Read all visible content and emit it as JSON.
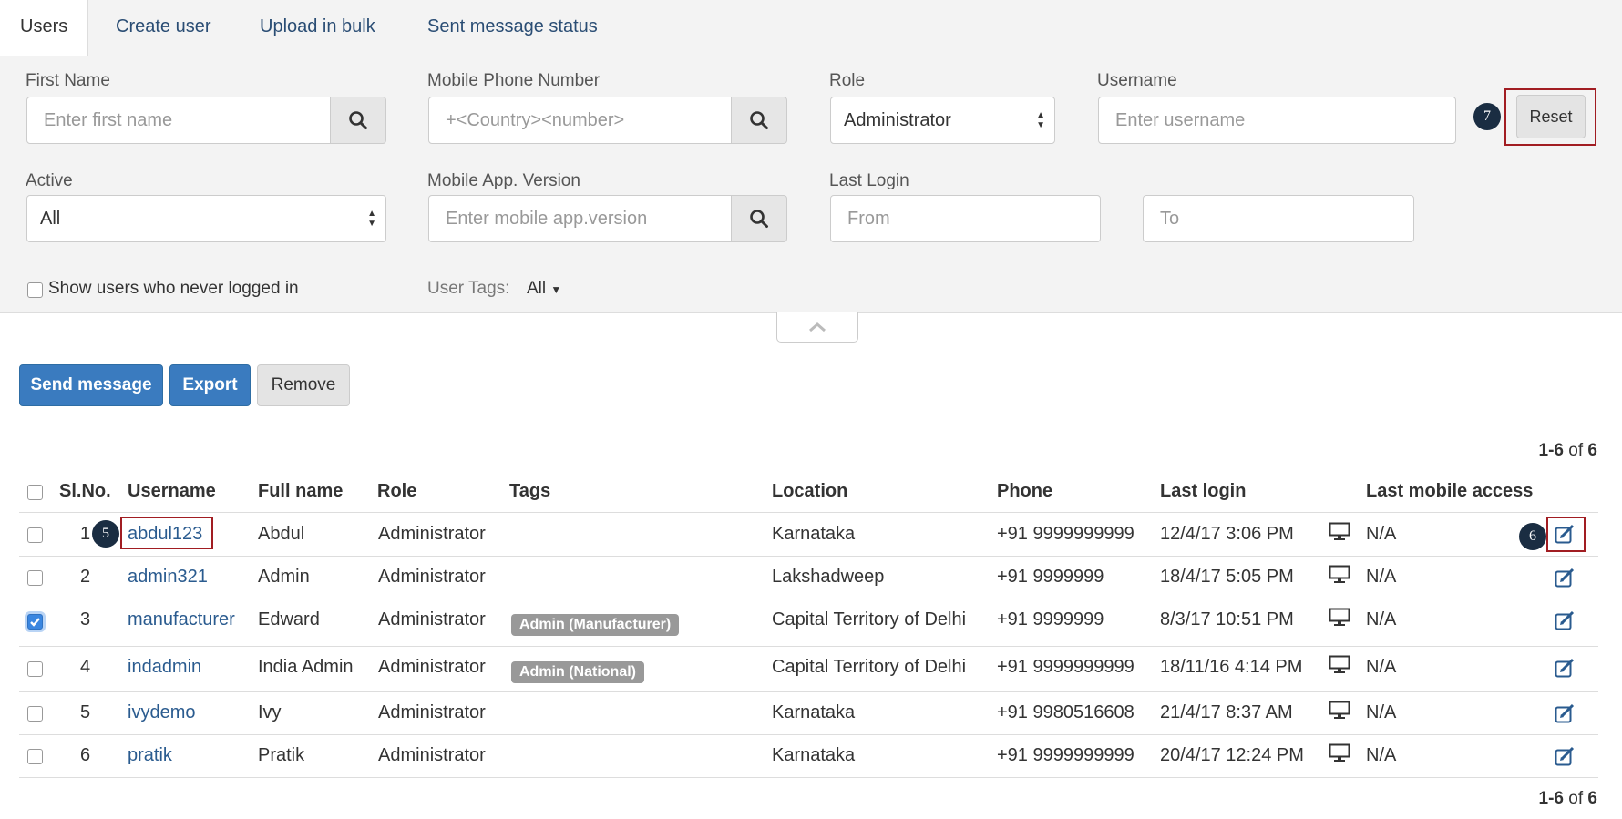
{
  "tabs": [
    {
      "label": "Users"
    },
    {
      "label": "Create user"
    },
    {
      "label": "Upload in bulk"
    },
    {
      "label": "Sent message status"
    }
  ],
  "filters": {
    "first_name": {
      "label": "First Name",
      "placeholder": "Enter first name"
    },
    "mobile_phone": {
      "label": "Mobile Phone Number",
      "placeholder": "+<Country><number>"
    },
    "role": {
      "label": "Role",
      "value": "Administrator"
    },
    "username": {
      "label": "Username",
      "placeholder": "Enter username"
    },
    "reset_label": "Reset",
    "active": {
      "label": "Active",
      "value": "All"
    },
    "app_version": {
      "label": "Mobile App. Version",
      "placeholder": "Enter mobile app.version"
    },
    "last_login": {
      "label": "Last Login",
      "from_placeholder": "From",
      "to_placeholder": "To"
    },
    "never_logged_in_label": "Show users who never logged in",
    "user_tags": {
      "label": "User Tags:",
      "value": "All"
    }
  },
  "callouts": {
    "five": "5",
    "six": "6",
    "seven": "7"
  },
  "actions": {
    "send_message": "Send message",
    "export": "Export",
    "remove": "Remove"
  },
  "pager": {
    "range": "1-6",
    "of": "of",
    "total": "6"
  },
  "table": {
    "headers": {
      "slno": "Sl.No.",
      "username": "Username",
      "fullname": "Full name",
      "role": "Role",
      "tags": "Tags",
      "location": "Location",
      "phone": "Phone",
      "last_login": "Last login",
      "last_mobile": "Last mobile access"
    },
    "rows": [
      {
        "slno": "1",
        "username": "abdul123",
        "fullname": "Abdul",
        "role": "Administrator",
        "tag": "",
        "location": "Karnataka",
        "phone": "+91 9999999999",
        "last_login": "12/4/17 3:06 PM",
        "last_mobile": "N/A",
        "checked": false
      },
      {
        "slno": "2",
        "username": "admin321",
        "fullname": "Admin",
        "role": "Administrator",
        "tag": "",
        "location": "Lakshadweep",
        "phone": "+91 9999999",
        "last_login": "18/4/17 5:05 PM",
        "last_mobile": "N/A",
        "checked": false
      },
      {
        "slno": "3",
        "username": "manufacturer",
        "fullname": "Edward",
        "role": "Administrator",
        "tag": "Admin (Manufacturer)",
        "location": "Capital Territory of Delhi",
        "phone": "+91 9999999",
        "last_login": "8/3/17 10:51 PM",
        "last_mobile": "N/A",
        "checked": true
      },
      {
        "slno": "4",
        "username": "indadmin",
        "fullname": "India Admin",
        "role": "Administrator",
        "tag": "Admin (National)",
        "location": "Capital Territory of Delhi",
        "phone": "+91 9999999999",
        "last_login": "18/11/16 4:14 PM",
        "last_mobile": "N/A",
        "checked": false
      },
      {
        "slno": "5",
        "username": "ivydemo",
        "fullname": "Ivy",
        "role": "Administrator",
        "tag": "",
        "location": "Karnataka",
        "phone": "+91 9980516608",
        "last_login": "21/4/17 8:37 AM",
        "last_mobile": "N/A",
        "checked": false
      },
      {
        "slno": "6",
        "username": "pratik",
        "fullname": "Pratik",
        "role": "Administrator",
        "tag": "",
        "location": "Karnataka",
        "phone": "+91 9999999999",
        "last_login": "20/4/17 12:24 PM",
        "last_mobile": "N/A",
        "checked": false
      }
    ]
  },
  "colors": {
    "primary": "#3a7bbf",
    "link": "#2a5b8f",
    "callout": "#1a2d42",
    "highlight_box": "#a11d22"
  },
  "icons": {
    "search": "search-icon",
    "monitor": "monitor-icon",
    "edit": "edit-icon",
    "collapse": "chevron-up-icon"
  }
}
